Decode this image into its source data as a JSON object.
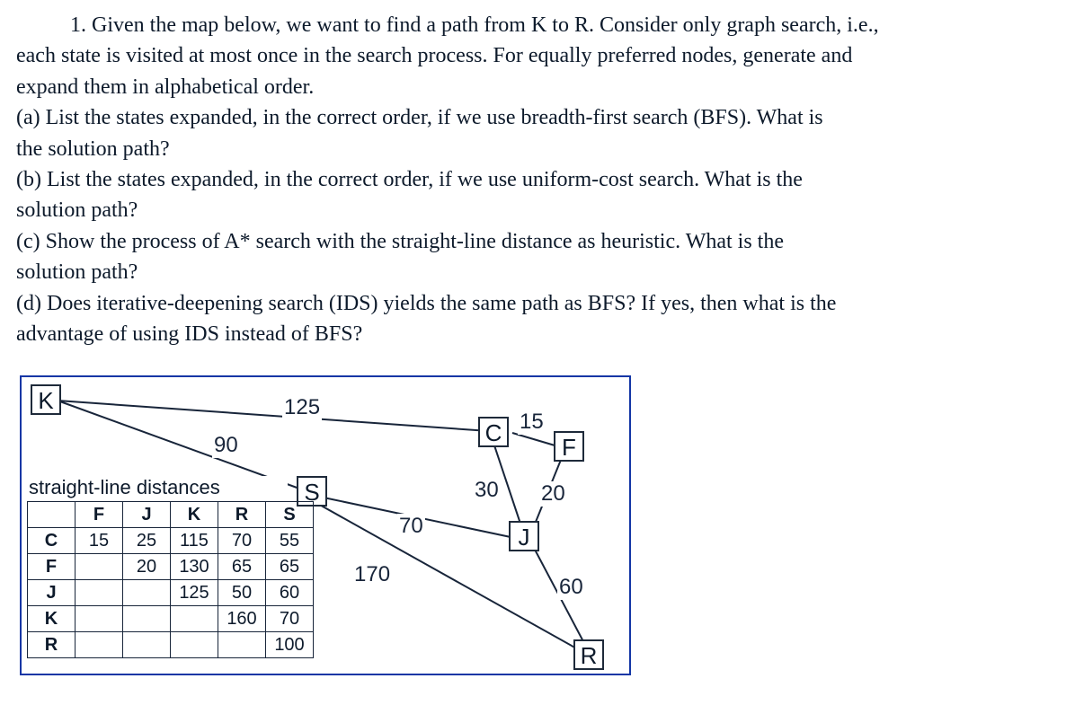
{
  "problem": {
    "number": "1.",
    "intro_line1": "Given the map below, we want to find a path from K to R. Consider only graph search, i.e.,",
    "intro_line2": "each state is visited at most once in the search process. For equally preferred nodes, generate and",
    "intro_line3": "expand them in alphabetical order.",
    "parts": {
      "a1": "(a) List the states expanded, in the correct order, if we use breadth-first search (BFS). What is",
      "a2": "the solution path?",
      "b1": "(b) List the states expanded, in the correct order, if we use uniform-cost search. What is the",
      "b2": "solution path?",
      "c1": "(c) Show the process of A* search with the straight-line distance as heuristic. What is the",
      "c2": "solution path?",
      "d1": "(d) Does iterative-deepening search (IDS) yields the same path as BFS? If yes, then what is the",
      "d2": "advantage of using IDS instead of BFS?"
    }
  },
  "graph": {
    "nodes": {
      "K": "K",
      "C": "C",
      "F": "F",
      "S": "S",
      "J": "J",
      "R": "R"
    },
    "edges": {
      "KC": "125",
      "KS": "90",
      "CF": "15",
      "CJ": "30",
      "FJ": "20",
      "SJ": "70",
      "SR": "170",
      "JR": "60"
    }
  },
  "sld": {
    "caption": "straight-line distances",
    "cols": [
      "F",
      "J",
      "K",
      "R",
      "S"
    ],
    "rows": [
      {
        "name": "C",
        "vals": [
          "15",
          "25",
          "115",
          "70",
          "55"
        ]
      },
      {
        "name": "F",
        "vals": [
          "",
          "20",
          "130",
          "65",
          "65"
        ]
      },
      {
        "name": "J",
        "vals": [
          "",
          "",
          "125",
          "50",
          "60"
        ]
      },
      {
        "name": "K",
        "vals": [
          "",
          "",
          "",
          "160",
          "70"
        ]
      },
      {
        "name": "R",
        "vals": [
          "",
          "",
          "",
          "",
          "100"
        ]
      }
    ]
  },
  "chart_data": {
    "type": "table",
    "title": "straight-line distances",
    "columns": [
      "",
      "F",
      "J",
      "K",
      "R",
      "S"
    ],
    "rows": [
      [
        "C",
        15,
        25,
        115,
        70,
        55
      ],
      [
        "F",
        null,
        20,
        130,
        65,
        65
      ],
      [
        "J",
        null,
        null,
        125,
        50,
        60
      ],
      [
        "K",
        null,
        null,
        null,
        160,
        70
      ],
      [
        "R",
        null,
        null,
        null,
        null,
        100
      ]
    ]
  }
}
